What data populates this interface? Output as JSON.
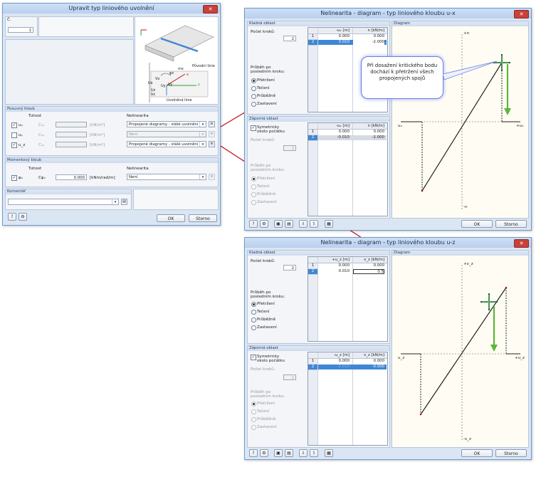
{
  "dlg1": {
    "title": "Upravit typ liniového uvolnění",
    "close": "✕",
    "no_label": "Č.",
    "no_value": "1",
    "fig_labels": {
      "orig": "Původní linie",
      "rel": "Uvolněná linie",
      "ux": "Ux",
      "uy": "Uy",
      "uz": "Uz",
      "vx": "Vx",
      "vy": "Vy",
      "vz": "Vz",
      "phix": "φx",
      "mx": "mx",
      "x": "x",
      "y": "y"
    },
    "posuvny": {
      "head": "Posuvný kloub",
      "tuhost": "Tuhost",
      "nelinearita": "Nelinearita",
      "rows": [
        {
          "sym": "uₓ",
          "c": "Cᵤₓ",
          "unit": "[kN/m²]",
          "checked": "✓",
          "nl": "Propojené diagramy - stálé uvolnění"
        },
        {
          "sym": "uᵧ",
          "c": "Cᵤᵧ",
          "unit": "[kN/m²]",
          "checked": "",
          "nl": "Není"
        },
        {
          "sym": "u_z",
          "c": "Cᵤᵤ",
          "unit": "[kN/m²]",
          "checked": "✓",
          "nl": "Propojené diagramy - stálé uvolnění"
        }
      ]
    },
    "momentovy": {
      "head": "Momentový kloub",
      "tuhost": "Tuhost",
      "nelinearita": "Nelinearita",
      "sym": "φₓ",
      "c": "Cφₓ",
      "value": "0.000",
      "unit": "[kNm/rad/m]",
      "checked": "✓",
      "nl": "Není"
    },
    "komentar": {
      "head": "Komentář"
    },
    "ok": "OK",
    "cancel": "Storno"
  },
  "dlg2": {
    "title": "Nelinearita - diagram - typ liniového kloubu u-x",
    "close": "✕",
    "positive": {
      "head": "Kladná oblast",
      "steps_label": "Počet kroků:",
      "steps_value": "2",
      "col1": "-uₓ [m]",
      "col2": "n [kN/m]",
      "rows": [
        {
          "n": "1",
          "u": "0.000",
          "v": "0.000"
        },
        {
          "n": "2",
          "u": "0.010",
          "v": "-2.000"
        }
      ],
      "after_label": "Průběh po posledním kroku:",
      "options": [
        "Přetržení",
        "Tečení",
        "Průběžně",
        "Zastavení"
      ]
    },
    "negative": {
      "head": "Záporná oblast",
      "sym_label": "Symetricky okolo počátku",
      "steps_label": "Počet kroků:",
      "steps_value": "2",
      "col1": "-uₓ [m]",
      "col2": "n [kN/m]",
      "rows": [
        {
          "n": "1",
          "u": "0.000",
          "v": "0.000"
        },
        {
          "n": "2",
          "u": "-0.010",
          "v": "-2.000"
        }
      ],
      "after_label": "Průběh po posledním kroku:",
      "options": [
        "Přetržení",
        "Tečení",
        "Průběžně",
        "Zastavení"
      ]
    },
    "diagram": {
      "head": "Diagram",
      "top": "+n",
      "bottom": "-n",
      "left": "uₓ",
      "right": "+uₓ"
    },
    "bubble": "Při dosažení kritického bodu dochází k přetržení všech propojených spojů",
    "ok": "OK",
    "cancel": "Storno"
  },
  "dlg3": {
    "title": "Nelinearita - diagram - typ liniového kloubu u-z",
    "close": "✕",
    "positive": {
      "head": "Kladná oblast",
      "steps_label": "Počet kroků:",
      "steps_value": "2",
      "col1": "+u_z [m]",
      "col2": "v_z [kN/m]",
      "rows": [
        {
          "n": "1",
          "u": "0.000",
          "v": "0.000"
        },
        {
          "n": "2",
          "u": "0.010",
          "v": "0.5"
        }
      ],
      "after_label": "Průběh po posledním kroku:",
      "options": [
        "Přetržení",
        "Tečení",
        "Průběžně",
        "Zastavení"
      ]
    },
    "negative": {
      "head": "Záporná oblast",
      "sym_label": "Symetricky okolo počátku",
      "steps_label": "Počet kroků:",
      "steps_value": "2",
      "col1": "-u_z [m]",
      "col2": "v_z [kN/m]",
      "rows": [
        {
          "n": "1",
          "u": "0.000",
          "v": "0.000"
        },
        {
          "n": "2",
          "u": "-0.010",
          "v": "-0.500"
        }
      ],
      "after_label": "Průběh po posledním kroku:",
      "options": [
        "Přetržení",
        "Tečení",
        "Průběžně",
        "Zastavení"
      ]
    },
    "diagram": {
      "head": "Diagram",
      "top": "+v_z",
      "bottom": "-v_z",
      "left": "u_z",
      "right": "+u_z"
    },
    "ok": "OK",
    "cancel": "Storno"
  },
  "colors": {
    "accent": "#3f86d6",
    "arrow": "#c0141c",
    "green": "#5fb33a",
    "close": "#c9423a"
  }
}
